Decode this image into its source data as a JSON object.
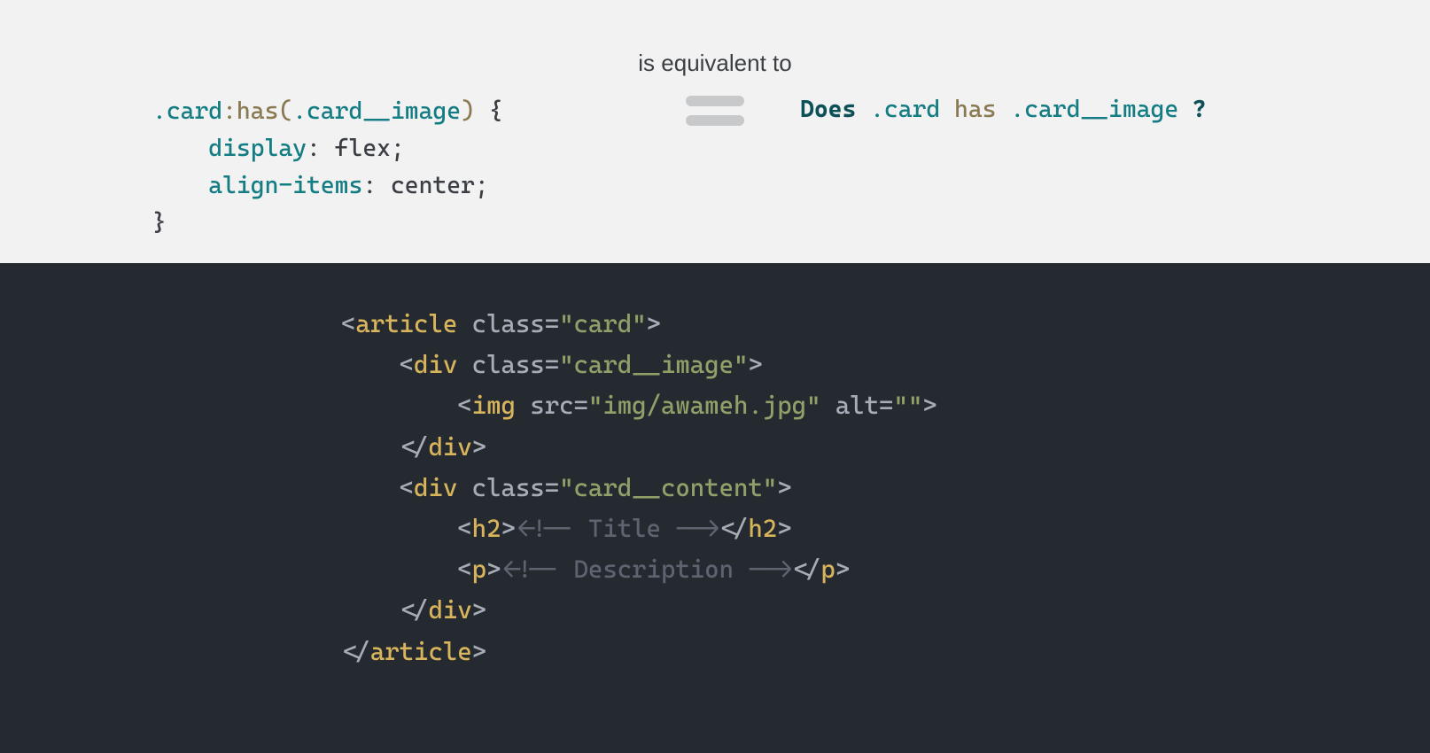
{
  "top": {
    "equiv_label": "is equivalent to",
    "css_line1_a": ".card",
    "css_line1_b": ":has(",
    "css_line1_c": ".card__image",
    "css_line1_d": ")",
    "css_line1_e": " {",
    "css_line2_prop": "display",
    "css_line2_colon": ": ",
    "css_line2_val": "flex;",
    "css_line3_prop": "align-items",
    "css_line3_colon": ": ",
    "css_line3_val": "center;",
    "css_line4": "}",
    "q_does": "Does ",
    "q_card": ".card ",
    "q_has": "has ",
    "q_img": ".card__image ",
    "q_qmark": "?"
  },
  "bottom": {
    "l1_a": "<",
    "l1_tag": "article",
    "l1_b": " ",
    "l1_attr": "class",
    "l1_c": "=",
    "l1_str": "\"card\"",
    "l1_d": ">",
    "l2_a": "<",
    "l2_tag": "div",
    "l2_b": " ",
    "l2_attr": "class",
    "l2_c": "=",
    "l2_str": "\"card__image\"",
    "l2_d": ">",
    "l3_a": "<",
    "l3_tag": "img",
    "l3_b": " ",
    "l3_attr1": "src",
    "l3_c": "=",
    "l3_str1": "\"img/awameh.jpg\"",
    "l3_d": " ",
    "l3_attr2": "alt",
    "l3_e": "=",
    "l3_str2": "\"\"",
    "l3_f": ">",
    "l4_a": "</",
    "l4_tag": "div",
    "l4_b": ">",
    "l5_a": "<",
    "l5_tag": "div",
    "l5_b": " ",
    "l5_attr": "class",
    "l5_c": "=",
    "l5_str": "\"card__content\"",
    "l5_d": ">",
    "l6_a": "<",
    "l6_tag": "h2",
    "l6_b": ">",
    "l6_cmt": "<!-- Title -->",
    "l6_c": "</",
    "l6_tag2": "h2",
    "l6_d": ">",
    "l7_a": "<",
    "l7_tag": "p",
    "l7_b": ">",
    "l7_cmt": "<!-- Description -->",
    "l7_c": "</",
    "l7_tag2": "p",
    "l7_d": ">",
    "l8_a": "</",
    "l8_tag": "div",
    "l8_b": ">",
    "l9_a": "</",
    "l9_tag": "article",
    "l9_b": ">"
  }
}
